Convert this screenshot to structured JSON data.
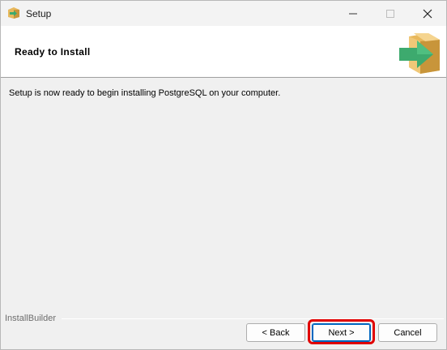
{
  "window": {
    "title": "Setup",
    "icons": {
      "app": "installer-box-icon",
      "minimize": "minimize-icon",
      "maximize": "maximize-icon",
      "close": "close-icon"
    }
  },
  "header": {
    "title": "Ready to Install",
    "icon": "installer-box-arrow-icon"
  },
  "body": {
    "message": "Setup is now ready to begin installing PostgreSQL on your computer."
  },
  "footer": {
    "brand": "InstallBuilder",
    "back_label": "< Back",
    "next_label": "Next >",
    "cancel_label": "Cancel"
  },
  "colors": {
    "box": "#e8b85c",
    "box_dark": "#c8953a",
    "arrow": "#3daa6e",
    "highlight": "#e00000",
    "default_button_border": "#0067c0"
  }
}
